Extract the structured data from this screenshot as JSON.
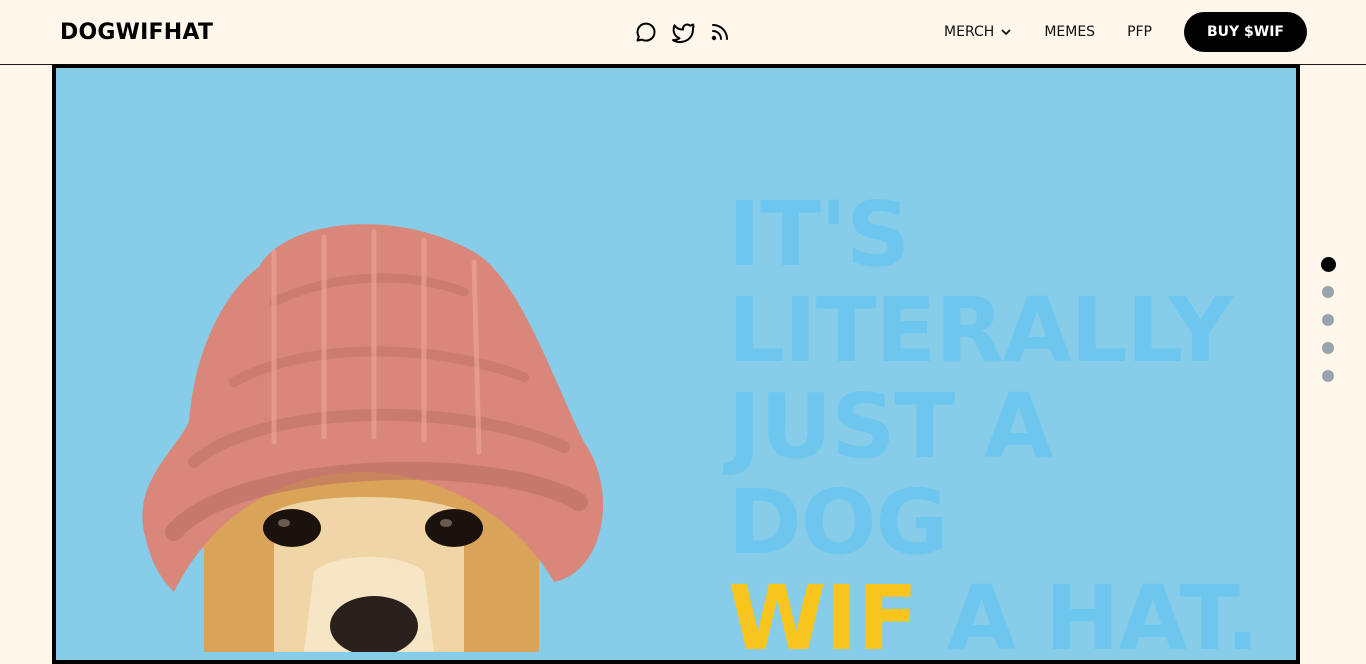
{
  "header": {
    "logo": "DOGWIFHAT",
    "socials": [
      {
        "icon": "chat-bubble-icon"
      },
      {
        "icon": "twitter-bird-icon"
      },
      {
        "icon": "rss-feed-icon"
      }
    ],
    "nav": {
      "merch": "MERCH",
      "memes": "MEMES",
      "pfp": "PFP",
      "buy": "BUY $WIF"
    }
  },
  "hero": {
    "headline_lines": [
      "IT'S",
      "LITERALLY",
      "JUST A",
      "DOG"
    ],
    "last_line_accent": "WIF",
    "last_line_rest": " A HAT.",
    "colors": {
      "background": "#87cde9",
      "headline": "#6dc6ee",
      "accent": "#f8c51c"
    }
  },
  "pagination": {
    "count": 5,
    "active_index": 0
  }
}
